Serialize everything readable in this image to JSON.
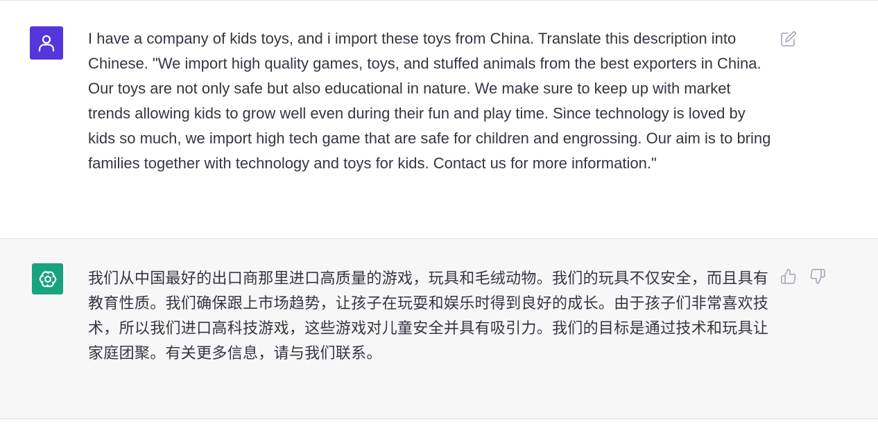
{
  "conversation": {
    "user_message": {
      "avatar_icon": "user-icon",
      "avatar_color": "#5436da",
      "text": "I have a company of kids toys, and i import these toys from China. Translate this description into Chinese.  \"We import high quality games, toys, and stuffed animals from the best exporters in China. Our toys are not only safe but also educational in nature. We make sure to keep up with market trends allowing kids to grow well even during their fun and play time. Since technology is loved by kids so much, we import high tech game that are safe for children and engrossing. Our aim is to bring families together with technology and toys for kids. Contact us for more information.\"",
      "edit_icon": "edit-icon"
    },
    "assistant_message": {
      "avatar_icon": "openai-logo-icon",
      "avatar_color": "#19a37f",
      "text": "我们从中国最好的出口商那里进口高质量的游戏，玩具和毛绒动物。我们的玩具不仅安全，而且具有教育性质。我们确保跟上市场趋势，让孩子在玩耍和娱乐时得到良好的成长。由于孩子们非常喜欢技术，所以我们进口高科技游戏，这些游戏对儿童安全并具有吸引力。我们的目标是通过技术和玩具让家庭团聚。有关更多信息，请与我们联系。",
      "feedback_icons": [
        "thumbs-up-icon",
        "thumbs-down-icon"
      ]
    }
  }
}
